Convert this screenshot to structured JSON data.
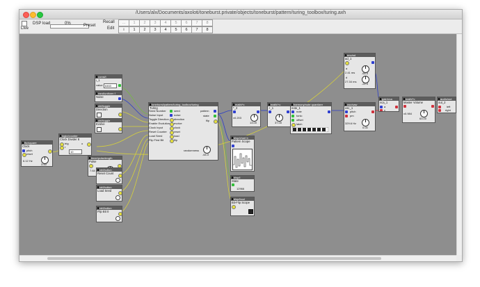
{
  "window": {
    "title": "/Users/alx/Documents/axoloti/toneburst.private/objects/toneburst/pattern/turing_toolbox/turing.axh"
  },
  "toolbar": {
    "live_label": "Live",
    "dsp_label": "DSP load",
    "dsp_value": "0%",
    "preset_label": "Preset",
    "recall_label": "Recall",
    "edit_label": "Edit",
    "recall_buttons": [
      "...",
      "1",
      "2",
      "3",
      "4",
      "5",
      "6",
      "7",
      "8"
    ],
    "edit_buttons": [
      "i",
      "1",
      "2",
      "3",
      "4",
      "5",
      "6",
      "7",
      "8"
    ]
  },
  "wire_colors": {
    "yellow": "#d8d23a",
    "green": "#78b846",
    "blue": "#2c3ec8",
    "red": "#cc2e3a"
  },
  "objects": {
    "const_val": {
      "header": "const/i",
      "instance": "i_1",
      "label": "value",
      "value": "6463"
    },
    "noise": {
      "header": "rand/uniform f",
      "instance": "Noise"
    },
    "direction": {
      "header": "ctrl/toggle",
      "instance": "Direction"
    },
    "evolve": {
      "header": "ctrl/toggle",
      "instance": "Evolve"
    },
    "clock": {
      "header": "lfo/square",
      "instance": "Clock",
      "pitch": "pitch",
      "reset": "reset",
      "value": "6.12 Hz",
      "knob_value": "3.00"
    },
    "divider": {
      "header": "logic/counter",
      "instance": "Clock Divider 8",
      "trig": "trig",
      "r": "r",
      "o": "o",
      "value": "10"
    },
    "pulse": {
      "header": "timer/pulselength",
      "instance": "Pulse",
      "value": "7.64 ms",
      "knob_value": "-64.0"
    },
    "reset_count": {
      "header": "ctrl/button",
      "instance": "Reset Count"
    },
    "load_seed": {
      "header": "ctrl/button",
      "instance": "Load Seed"
    },
    "flip_bit": {
      "header": "ctrl/button",
      "instance": "Flip Bit 0"
    },
    "turing": {
      "header": "toneburst/pattern/turing_toolbox/turing",
      "instance": "Turing",
      "inlets_left": [
        "Seed Number",
        "Noise Input",
        "Toggle Direction",
        "Enable Evolution",
        "Clock Input",
        "Reset Counter",
        "Load Seed",
        "Flip First Bit"
      ],
      "inlets_right": [
        "seed",
        "noise",
        "direction",
        "evolve",
        "clock",
        "reset",
        "load",
        "flip"
      ],
      "outlets": [
        "pattern",
        "state",
        "flip"
      ],
      "randomness_label": "randomness",
      "randomness_value": "-64.0"
    },
    "math1": {
      "header": "math/*c",
      "instance": "*_2",
      "value": "x0.203",
      "knob_value": "13.00"
    },
    "math2": {
      "header": "math/+c",
      "instance": "+_1",
      "knob_value": "37.00"
    },
    "scope": {
      "header": "disp/chart b",
      "instance": "Pattern Scope"
    },
    "state_disp": {
      "header": "disp/i",
      "instance": "State",
      "value": "12966"
    },
    "flip_scope": {
      "header": "disp/bool",
      "instance": "Bit-Flip Scope"
    },
    "quantizer": {
      "header": "harmony/note quantizer",
      "instance": "note_1",
      "rows": [
        "note",
        "tonic",
        "offset",
        "latch"
      ]
    },
    "osc": {
      "header": "osc/saw",
      "instance": "osc_1",
      "pitch": "pitch",
      "pm": "pm",
      "value": "329.6 Hz",
      "knob_value": "0.00"
    },
    "env": {
      "header": "env/ad",
      "instance": "ad_1",
      "a_label": "a",
      "d_label": "d",
      "a_value": "2.41 ms",
      "a_knob": "-64.0",
      "d_value": "27.34 ms",
      "d_knob": "-22.0"
    },
    "vca": {
      "header": "gain/vca",
      "instance": "vca_1",
      "inlet1": "a",
      "inlet2": "v"
    },
    "master": {
      "header": "math/*c",
      "instance": "Master Volume",
      "value": "x0.984",
      "knob_value": "63.00"
    },
    "out": {
      "header": "audio/out",
      "instance": "out_2",
      "left": "left",
      "right": "right"
    }
  }
}
